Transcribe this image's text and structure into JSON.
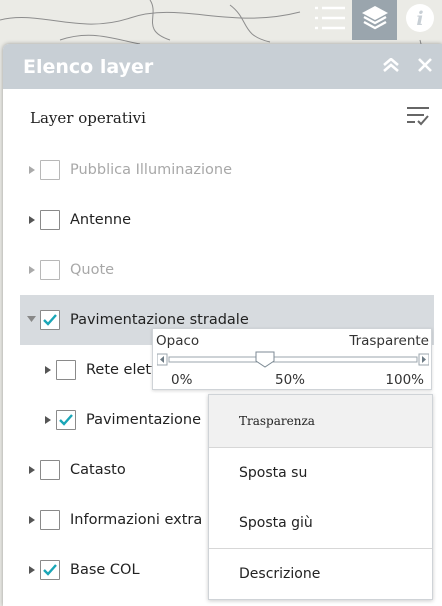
{
  "panel": {
    "title": "Elenco layer",
    "subtitle": "Layer operativi"
  },
  "layers": [
    {
      "label": "Pubblica Illuminazione",
      "checked": false,
      "dimmed": true
    },
    {
      "label": "Antenne",
      "checked": false,
      "dimmed": false
    },
    {
      "label": "Quote",
      "checked": false,
      "dimmed": true
    },
    {
      "label": "Pavimentazione stradale",
      "checked": true,
      "dimmed": false,
      "selected": true,
      "expanded": true
    },
    {
      "label": "Rete elett",
      "checked": false,
      "dimmed": false,
      "child": true
    },
    {
      "label": "Pavimentazione",
      "checked": true,
      "dimmed": false,
      "child": true
    },
    {
      "label": "Catasto",
      "checked": false,
      "dimmed": false
    },
    {
      "label": "Informazioni extra",
      "checked": false,
      "dimmed": false
    },
    {
      "label": "Base COL",
      "checked": true,
      "dimmed": false
    }
  ],
  "transparency_slider": {
    "left_label": "Opaco",
    "right_label": "Trasparente",
    "tick_min": "0%",
    "tick_mid": "50%",
    "tick_max": "100%",
    "value_percent": 50
  },
  "context_menu": {
    "items": [
      "Trasparenza",
      "Sposta su",
      "Sposta giù",
      "Descrizione"
    ]
  },
  "colors": {
    "header_bg": "#c8cfd5",
    "check": "#1aa6b7",
    "active_tool": "#9aa5ad"
  },
  "icons": [
    "legend-icon",
    "layers-icon",
    "info-icon",
    "collapse-icon",
    "close-icon",
    "filter-icon",
    "caret-right-icon",
    "caret-down-icon",
    "checkmark-icon"
  ]
}
